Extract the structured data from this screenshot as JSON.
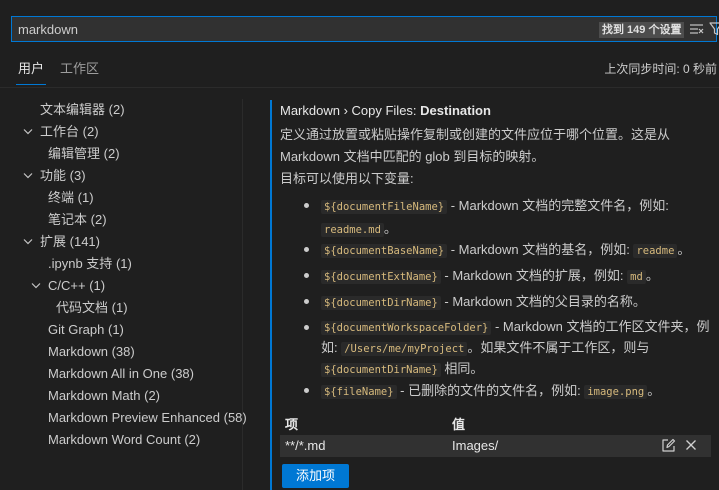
{
  "search": {
    "value": "markdown",
    "result_count": "找到 149 个设置"
  },
  "tabs": {
    "user": "用户",
    "workspace": "工作区",
    "sync_status": "上次同步时间: 0 秒前"
  },
  "tree": [
    {
      "label": "文本编辑器",
      "count": "(2)"
    },
    {
      "label": "工作台",
      "count": "(2)"
    },
    {
      "label": "编辑管理",
      "count": "(2)"
    },
    {
      "label": "功能",
      "count": "(3)"
    },
    {
      "label": "终端",
      "count": "(1)"
    },
    {
      "label": "笔记本",
      "count": "(2)"
    },
    {
      "label": "扩展",
      "count": "(141)"
    },
    {
      "label": ".ipynb 支持",
      "count": "(1)"
    },
    {
      "label": "C/C++",
      "count": "(1)"
    },
    {
      "label": "代码文档",
      "count": "(1)"
    },
    {
      "label": "Git Graph",
      "count": "(1)"
    },
    {
      "label": "Markdown",
      "count": "(38)"
    },
    {
      "label": "Markdown All in One",
      "count": "(38)"
    },
    {
      "label": "Markdown Math",
      "count": "(2)"
    },
    {
      "label": "Markdown Preview Enhanced",
      "count": "(58)"
    },
    {
      "label": "Markdown Word Count",
      "count": "(2)"
    }
  ],
  "setting": {
    "title_prefix": "Markdown › Copy Files: ",
    "title_name": "Destination",
    "description": "定义通过放置或粘贴操作复制或创建的文件应位于哪个位置。这是从 Markdown 文档中匹配的 glob 到目标的映射。",
    "vars_intro": "目标可以使用以下变量:",
    "bullets": [
      {
        "code": "${documentFileName}",
        "text": " - Markdown 文档的完整文件名，例如: ",
        "code2": "readme.md",
        "tail": "。"
      },
      {
        "code": "${documentBaseName}",
        "text": " - Markdown 文档的基名，例如: ",
        "code2": "readme",
        "tail": "。"
      },
      {
        "code": "${documentExtName}",
        "text": " - Markdown 文档的扩展，例如: ",
        "code2": "md",
        "tail": "。"
      },
      {
        "code": "${documentDirName}",
        "text": " - Markdown 文档的父目录的名称。"
      },
      {
        "code": "${documentWorkspaceFolder}",
        "text": " - Markdown 文档的工作区文件夹，例如: ",
        "code2": "/Users/me/myProject",
        "text2": "。如果文件不属于工作区，则与 ",
        "code3": "${documentDirName}",
        "tail": " 相同。"
      },
      {
        "code": "${fileName}",
        "text": " - 已删除的文件的文件名，例如: ",
        "code2": "image.png",
        "tail": "。"
      }
    ],
    "table": {
      "col_item": "项",
      "col_value": "值",
      "rows": [
        {
          "item": "**/*.md",
          "value": "Images/"
        }
      ]
    },
    "add_button": "添加项"
  }
}
